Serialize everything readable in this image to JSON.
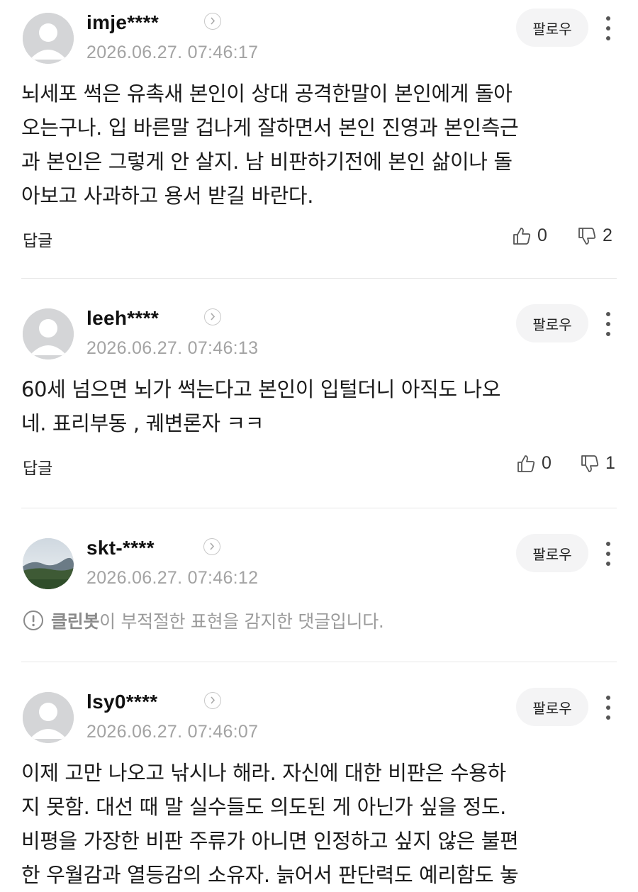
{
  "common": {
    "follow_label": "팔로우",
    "reply_label": "답글"
  },
  "comments": [
    {
      "username": "imje****",
      "timestamp": "2026.06.27. 07:46:17",
      "text": "뇌세포 썩은 유촉새 본인이 상대 공격한말이 본인에게 돌아\n오는구나. 입 바른말 겁나게 잘하면서 본인 진영과 본인측근\n과 본인은 그렇게 안 살지. 남 비판하기전에 본인 삶이나 돌\n아보고 사과하고 용서 받길 바란다.",
      "likes": "0",
      "dislikes": "2",
      "avatar": "default-avatar"
    },
    {
      "username": "leeh****",
      "timestamp": "2026.06.27. 07:46:13",
      "text": "60세 넘으면 뇌가 썩는다고 본인이 입털더니 아직도 나오\n네. 표리부동 , 궤변론자 ㅋㅋ",
      "likes": "0",
      "dislikes": "1",
      "avatar": "default-avatar"
    },
    {
      "username": "skt-****",
      "timestamp": "2026.06.27. 07:46:12",
      "cleanbot_name": "클린봇",
      "cleanbot_message": "이 부적절한 표현을 감지한 댓글입니다.",
      "avatar": "landscape-photo-avatar"
    },
    {
      "username": "lsy0****",
      "timestamp": "2026.06.27. 07:46:07",
      "text": "이제 고만 나오고 낚시나 해라. 자신에 대한 비판은 수용하\n지 못함. 대선 때 말 실수들도 의도된 게 아닌가 싶을 정도.\n비평을 가장한 비판 주류가 아니면 인정하고 싶지 않은 불편\n한 우월감과 열등감의 소유자. 늙어서 판단력도 예리함도 놓",
      "avatar": "default-avatar"
    }
  ],
  "colors": {
    "meta_gray": "#a3a3a3",
    "follow_bg": "#f4f4f5",
    "divider": "#e6e6e6"
  }
}
